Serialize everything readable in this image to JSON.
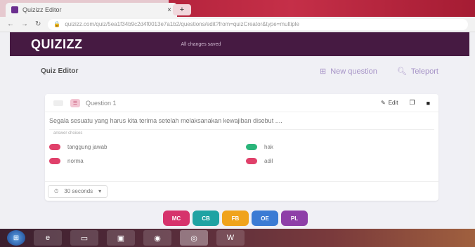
{
  "browser": {
    "tab_title": "Quizizz Editor",
    "tab_close": "×",
    "new_tab": "+",
    "url": "quizizz.com/quiz/5ea1f34b9c2d4f0013e7a1b2/questions/edit?from=quizCreator&type=multiple",
    "back": "←",
    "forward": "→",
    "reload": "↻"
  },
  "header": {
    "logo": "QUIZIZZ",
    "subtitle": "All changes saved"
  },
  "editor": {
    "title": "Quiz Editor",
    "new_question": "New question",
    "teleport": "Teleport"
  },
  "question": {
    "label": "Question 1",
    "edit": "Edit",
    "text": "Segala sesuatu yang harus kita terima setelah melaksanakan kewajiban disebut ....",
    "answer_hint": "answer choices",
    "options": [
      {
        "text": "tanggung jawab",
        "color": "#e0406a"
      },
      {
        "text": "hak",
        "color": "#2ab57a"
      },
      {
        "text": "norma",
        "color": "#e0406a"
      },
      {
        "text": "adil",
        "color": "#e0406a"
      }
    ],
    "timer": "30 seconds",
    "timer_caret": "▾"
  },
  "type_buttons": [
    {
      "label": "MC",
      "color": "#d6336c"
    },
    {
      "label": "CB",
      "color": "#1fa3a3"
    },
    {
      "label": "FB",
      "color": "#f0a31c"
    },
    {
      "label": "OE",
      "color": "#3b7bd4"
    },
    {
      "label": "PL",
      "color": "#8e3fa8"
    }
  ]
}
